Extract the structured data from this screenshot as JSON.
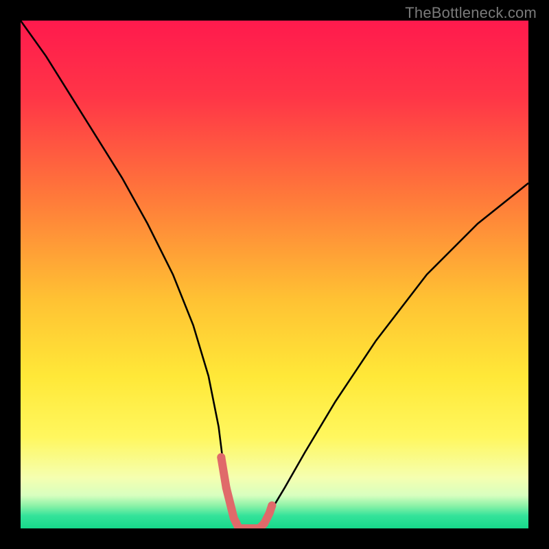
{
  "watermark": {
    "text": "TheBottleneck.com"
  },
  "chart_data": {
    "type": "line",
    "title": "",
    "xlabel": "",
    "ylabel": "",
    "xlim": [
      0,
      100
    ],
    "ylim": [
      0,
      100
    ],
    "grid": false,
    "legend": null,
    "gradient_stops": [
      {
        "pos": 0.0,
        "color": "#ff1a4d"
      },
      {
        "pos": 0.15,
        "color": "#ff3547"
      },
      {
        "pos": 0.35,
        "color": "#ff7a3a"
      },
      {
        "pos": 0.55,
        "color": "#ffc233"
      },
      {
        "pos": 0.7,
        "color": "#ffe838"
      },
      {
        "pos": 0.82,
        "color": "#fff75e"
      },
      {
        "pos": 0.9,
        "color": "#f5ffb0"
      },
      {
        "pos": 0.935,
        "color": "#d8ffbf"
      },
      {
        "pos": 0.955,
        "color": "#8df2a8"
      },
      {
        "pos": 0.975,
        "color": "#34e39a"
      },
      {
        "pos": 1.0,
        "color": "#17d98b"
      }
    ],
    "series": [
      {
        "name": "bottleneck-curve",
        "color": "#000000",
        "x": [
          0,
          5,
          10,
          15,
          20,
          25,
          30,
          34,
          37,
          39,
          40,
          41,
          42,
          43,
          44,
          45,
          46,
          47,
          48,
          49,
          52,
          56,
          62,
          70,
          80,
          90,
          100
        ],
        "values": [
          100,
          93,
          85,
          77,
          69,
          60,
          50,
          40,
          30,
          20,
          12,
          6,
          2,
          0,
          0,
          0,
          0,
          0,
          1,
          3,
          8,
          15,
          25,
          37,
          50,
          60,
          68
        ]
      },
      {
        "name": "trough-highlight",
        "color": "#e06a6a",
        "x": [
          39.5,
          40,
          40.5,
          41,
          41.5,
          42,
          42.5,
          43,
          43.5,
          44,
          44.5,
          45,
          45.5,
          46,
          46.5,
          47,
          47.5,
          48,
          48.5,
          49,
          49.5
        ],
        "values": [
          14,
          11,
          8,
          6,
          4,
          2,
          1,
          0,
          0,
          0,
          0,
          0,
          0,
          0,
          0,
          0,
          0.5,
          1,
          2,
          3,
          4.5
        ]
      }
    ],
    "trough_dots": {
      "color": "#e06a6a",
      "points": [
        {
          "x": 39.5,
          "y": 14,
          "r": 6
        },
        {
          "x": 40.5,
          "y": 8,
          "r": 6
        },
        {
          "x": 41.5,
          "y": 4,
          "r": 6
        },
        {
          "x": 47.5,
          "y": 0.5,
          "r": 6
        },
        {
          "x": 48.5,
          "y": 2,
          "r": 6
        },
        {
          "x": 49.5,
          "y": 4.5,
          "r": 6
        }
      ]
    }
  }
}
